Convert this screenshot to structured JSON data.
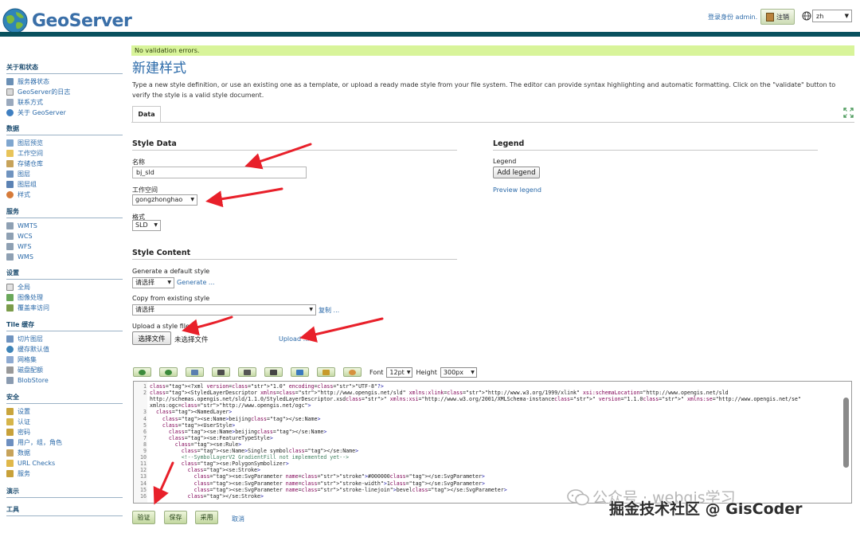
{
  "header": {
    "logo_text": "GeoServer",
    "login_text": "登录身份 admin.",
    "logout_label": "注销",
    "language": "zh"
  },
  "sidebar": {
    "sections": [
      {
        "heading": "关于和状态",
        "items": [
          "服务器状态",
          "GeoServer的日志",
          "联系方式",
          "关于 GeoServer"
        ]
      },
      {
        "heading": "数据",
        "items": [
          "图层预览",
          "工作空间",
          "存储仓库",
          "图层",
          "图层组",
          "样式"
        ]
      },
      {
        "heading": "服务",
        "items": [
          "WMTS",
          "WCS",
          "WFS",
          "WMS"
        ]
      },
      {
        "heading": "设置",
        "items": [
          "全局",
          "图像处理",
          "覆盖率访问"
        ]
      },
      {
        "heading": "Tile 缓存",
        "items": [
          "切片图层",
          "缓存默认值",
          "网格集",
          "磁盘配额",
          "BlobStore"
        ]
      },
      {
        "heading": "安全",
        "items": [
          "设置",
          "认证",
          "密码",
          "用户，组，角色",
          "数据",
          "URL Checks",
          "服务"
        ]
      },
      {
        "heading": "演示",
        "items": []
      },
      {
        "heading": "工具",
        "items": []
      }
    ]
  },
  "main": {
    "validation": "No validation errors.",
    "title": "新建样式",
    "description": "Type a new style definition, or use an existing one as a template, or upload a ready made style from your file system. The editor can provide syntax highlighting and automatic formatting. Click on the \"validate\" button to verify the style is a valid style document.",
    "tab": "Data",
    "style_data": {
      "heading": "Style Data",
      "name_label": "名称",
      "name_value": "bj_sld",
      "workspace_label": "工作空间",
      "workspace_value": "gongzhonghao",
      "format_label": "格式",
      "format_value": "SLD"
    },
    "legend": {
      "heading": "Legend",
      "label": "Legend",
      "add_button": "Add legend",
      "preview_link": "Preview legend"
    },
    "style_content": {
      "heading": "Style Content",
      "generate_label": "Generate a default style",
      "generate_select": "请选择",
      "generate_link": "Generate ...",
      "copy_label": "Copy from existing style",
      "copy_select": "请选择",
      "copy_link": "复制 ...",
      "upload_label": "Upload a style file",
      "choose_file_button": "选择文件",
      "no_file_text": "未选择文件",
      "upload_link": "Upload ..."
    },
    "toolbar": {
      "font_label": "Font",
      "font_value": "12pt",
      "height_label": "Height",
      "height_value": "300px"
    },
    "editor_lines": [
      {
        "n": "1",
        "text": "<?xml version=\"1.0\" encoding=\"UTF-8\"?>"
      },
      {
        "n": "2",
        "text": "<StyledLayerDescriptor xmlns=\"http://www.opengis.net/sld\" xmlns:xlink=\"http://www.w3.org/1999/xlink\" xsi:schemaLocation=\"http://www.opengis.net/sld"
      },
      {
        "n": "",
        "text": "http://schemas.opengis.net/sld/1.1.0/StyledLayerDescriptor.xsd\" xmlns:xsi=\"http://www.w3.org/2001/XMLSchema-instance\" version=\"1.1.0\" xmlns:se=\"http://www.opengis.net/se\""
      },
      {
        "n": "",
        "text": "xmlns:ogc=\"http://www.opengis.net/ogc\">"
      },
      {
        "n": "3",
        "text": "  <NamedLayer>"
      },
      {
        "n": "4",
        "text": "    <se:Name>beijing</se:Name>"
      },
      {
        "n": "5",
        "text": "    <UserStyle>"
      },
      {
        "n": "6",
        "text": "      <se:Name>beijing</se:Name>"
      },
      {
        "n": "7",
        "text": "      <se:FeatureTypeStyle>"
      },
      {
        "n": "8",
        "text": "        <se:Rule>"
      },
      {
        "n": "9",
        "text": "          <se:Name>Single symbol</se:Name>"
      },
      {
        "n": "10",
        "text": "          <!--SymbolLayerV2 GradientFill not implemented yet-->"
      },
      {
        "n": "11",
        "text": "          <se:PolygonSymbolizer>"
      },
      {
        "n": "12",
        "text": "            <se:Stroke>"
      },
      {
        "n": "13",
        "text": "              <se:SvgParameter name=\"stroke\">#000000</se:SvgParameter>"
      },
      {
        "n": "14",
        "text": "              <se:SvgParameter name=\"stroke-width\">1</se:SvgParameter>"
      },
      {
        "n": "15",
        "text": "              <se:SvgParameter name=\"stroke-linejoin\">bevel</se:SvgParameter>"
      },
      {
        "n": "16",
        "text": "            </se:Stroke>"
      }
    ],
    "footer": {
      "validate": "验证",
      "save": "保存",
      "apply": "采用",
      "cancel": "取消"
    }
  },
  "watermark": {
    "line1": "公众号 · webgis学习",
    "line2": "掘金技术社区 @ GisCoder"
  },
  "colors": {
    "link": "#2b6aa9",
    "header_band": "#08515e",
    "validation_bg": "#d8f49a",
    "annotation_arrow": "#e8202a"
  }
}
